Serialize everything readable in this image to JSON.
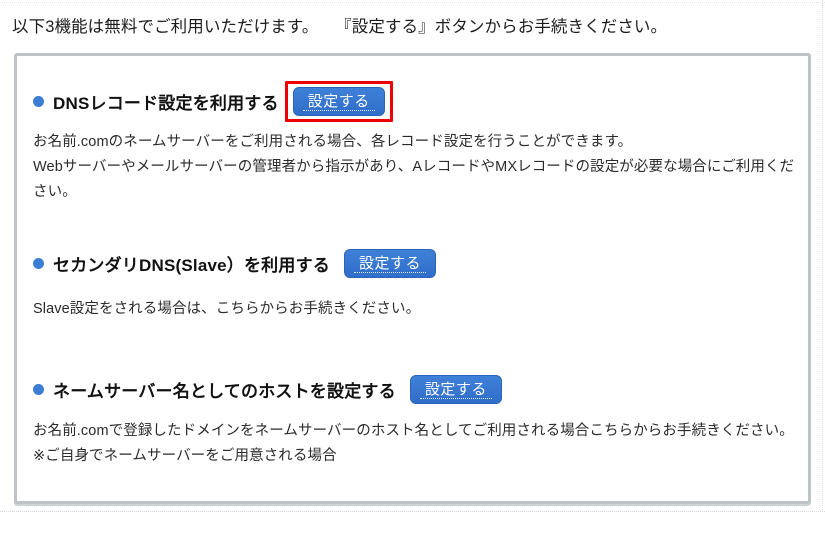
{
  "intro": {
    "text": "以下3機能は無料でご利用いただけます。　　『設定する』ボタンからお手続きください。"
  },
  "panel": {
    "sections": [
      {
        "bullet_icon": "bullet-circle-icon",
        "title": "DNSレコード設定を利用する",
        "button_label": "設定する",
        "highlighted": true,
        "body": "お名前.comのネームサーバーをご利用される場合、各レコード設定を行うことができます。\nWebサーバーやメールサーバーの管理者から指示があり、AレコードやMXレコードの設定が必要な場合にご利用ください。"
      },
      {
        "bullet_icon": "bullet-circle-icon",
        "title": "セカンダリDNS(Slave）を利用する",
        "button_label": "設定する",
        "highlighted": false,
        "body": "Slave設定をされる場合は、こちらからお手続きください。"
      },
      {
        "bullet_icon": "bullet-circle-icon",
        "title": "ネームサーバー名としてのホストを設定する",
        "button_label": "設定する",
        "highlighted": false,
        "body": "お名前.comで登録したドメインをネームサーバーのホスト名としてご利用される場合こちらからお手続きください。\n※ご自身でネームサーバーをご用意される場合"
      }
    ]
  },
  "colors": {
    "button_blue": "#3577d2",
    "bullet_blue": "#3b7fd4",
    "highlight_red": "#ee0000",
    "panel_border_gray": "#bfc2c7"
  }
}
